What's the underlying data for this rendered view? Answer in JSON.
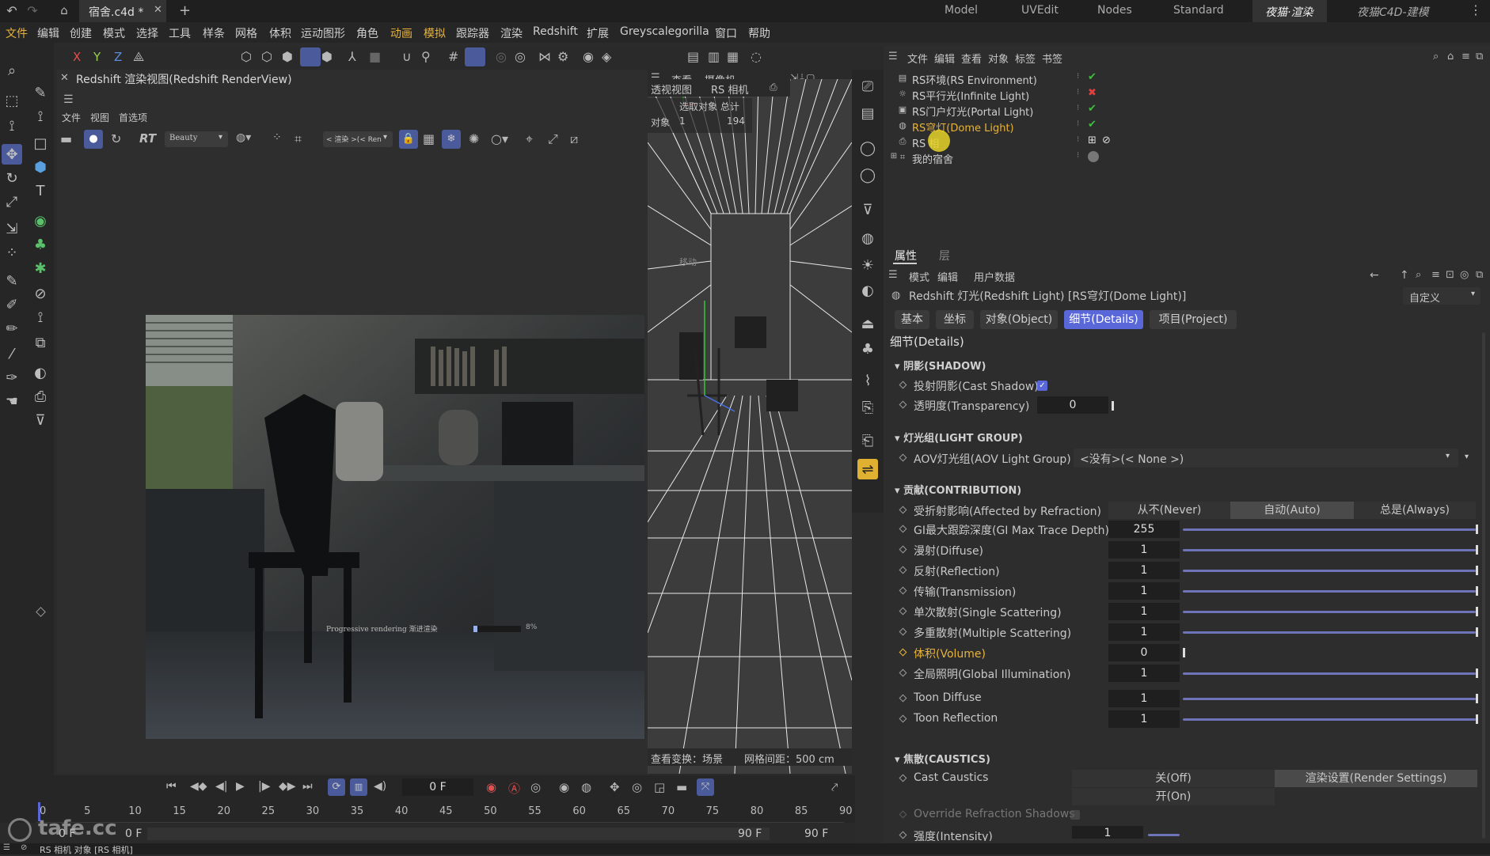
{
  "titlebar": {
    "tab_name": "宿舍.c4d *",
    "workspaces": [
      "Model",
      "UVEdit",
      "Nodes",
      "Standard",
      "夜猫·渲染",
      "夜猫C4D-建模"
    ],
    "active_workspace": "夜猫·渲染"
  },
  "menu": [
    "文件",
    "编辑",
    "创建",
    "模式",
    "选择",
    "工具",
    "样条",
    "网格",
    "体积",
    "运动图形",
    "角色",
    "动画",
    "模拟",
    "跟踪器",
    "渲染",
    "Redshift",
    "扩展",
    "Greyscalegorilla",
    "窗口",
    "帮助"
  ],
  "axes": {
    "x": "X",
    "y": "Y",
    "z": "Z"
  },
  "renderview": {
    "title": "Redshift 渲染视图(Redshift RenderView)",
    "menu": [
      "文件",
      "视图",
      "首选项"
    ],
    "aov": "Beauty",
    "rt": "RT",
    "render_dropdown": "< 渲染 >(< Ren",
    "progress_label": "Progressive rendering 渐进渲染",
    "progress_pct": "8%",
    "progress_value": 0.08
  },
  "viewport": {
    "menu": [
      "查看",
      "摄像机"
    ],
    "tab_label": "透视视图",
    "camera_label": "RS 相机",
    "stats_header": "选取对象 总计",
    "stats_label": "对象",
    "stats_selected": "1",
    "stats_total": "194",
    "move_label": "移动",
    "footer_left": "查看变换：场景",
    "footer_right": "网格间距：500 cm"
  },
  "objmgr": {
    "menu": [
      "文件",
      "编辑",
      "查看",
      "对象",
      "标签",
      "书签"
    ],
    "rows": [
      {
        "name": "RS环境(RS Environment)",
        "status": "check"
      },
      {
        "name": "RS平行光(Infinite Light)",
        "status": "cross"
      },
      {
        "name": "RS门户灯光(Portal Light)",
        "status": "check"
      },
      {
        "name": "RS穹灯(Dome Light)",
        "status": "check",
        "selected": true
      },
      {
        "name": "RS 相机",
        "status": "none"
      },
      {
        "name": "我的宿舍",
        "status": "none"
      }
    ]
  },
  "attr": {
    "tabs": [
      "属性",
      "层"
    ],
    "menu": [
      "模式",
      "编辑",
      "用户数据"
    ],
    "object_title": "Redshift 灯光(Redshift Light) [RS穹灯(Dome Light)]",
    "preset": "自定义",
    "subtabs": [
      "基本",
      "坐标",
      "对象(Object)",
      "细节(Details)",
      "项目(Project)"
    ],
    "active_subtab": "细节(Details)",
    "page_title": "细节(Details)",
    "shadow_header": "阴影(SHADOW)",
    "cast_shadow": "投射阴影(Cast Shadow)",
    "transparency": {
      "label": "透明度(Transparency)",
      "value": "0"
    },
    "lightgroup_header": "灯光组(LIGHT GROUP)",
    "aov_group": {
      "label": "AOV灯光组(AOV Light Group)",
      "value": "<没有>(< None >)"
    },
    "contribution_header": "贡献(CONTRIBUTION)",
    "refraction": {
      "label": "受折射影响(Affected by Refraction)",
      "options": [
        "从不(Never)",
        "自动(Auto)",
        "总是(Always)"
      ],
      "selected": "自动(Auto)"
    },
    "rows": [
      {
        "label": "GI最大跟踪深度(GI Max Trace Depth)",
        "value": "255",
        "fill": 1.0
      },
      {
        "label": "漫射(Diffuse)",
        "value": "1",
        "fill": 1.0
      },
      {
        "label": "反射(Reflection)",
        "value": "1",
        "fill": 1.0
      },
      {
        "label": "传输(Transmission)",
        "value": "1",
        "fill": 1.0
      },
      {
        "label": "单次散射(Single Scattering)",
        "value": "1",
        "fill": 1.0
      },
      {
        "label": "多重散射(Multiple Scattering)",
        "value": "1",
        "fill": 1.0
      },
      {
        "label": "体积(Volume)",
        "value": "0",
        "fill": 0.0,
        "highlight": true
      },
      {
        "label": "全局照明(Global Illumination)",
        "value": "1",
        "fill": 1.0
      },
      {
        "label": "Toon Diffuse",
        "value": "1",
        "fill": 1.0
      },
      {
        "label": "Toon Reflection",
        "value": "1",
        "fill": 1.0
      }
    ],
    "caustics_header": "焦散(CAUSTICS)",
    "cast_caustics": {
      "label": "Cast Caustics",
      "off": "关(Off)",
      "render_settings": "渲染设置(Render Settings)",
      "on": "开(On)"
    },
    "override_refraction": "Override Refraction Shadows",
    "intensity": {
      "label": "强度(Intensity)",
      "value": "1"
    }
  },
  "timeline": {
    "frame": "0 F",
    "ticks": [
      "0",
      "5",
      "10",
      "15",
      "20",
      "25",
      "30",
      "35",
      "40",
      "45",
      "50",
      "55",
      "60",
      "65",
      "70",
      "75",
      "80",
      "85",
      "90"
    ],
    "start": "0 F",
    "start2": "0 F",
    "end": "90 F",
    "end2": "90 F"
  },
  "statusbar": {
    "text": "RS 相机 对象 [RS 相机]"
  },
  "colors": {
    "accent": "#5a67d8",
    "check": "#3fbf3f",
    "cross": "#e04040",
    "highlight": "#e0b030"
  }
}
